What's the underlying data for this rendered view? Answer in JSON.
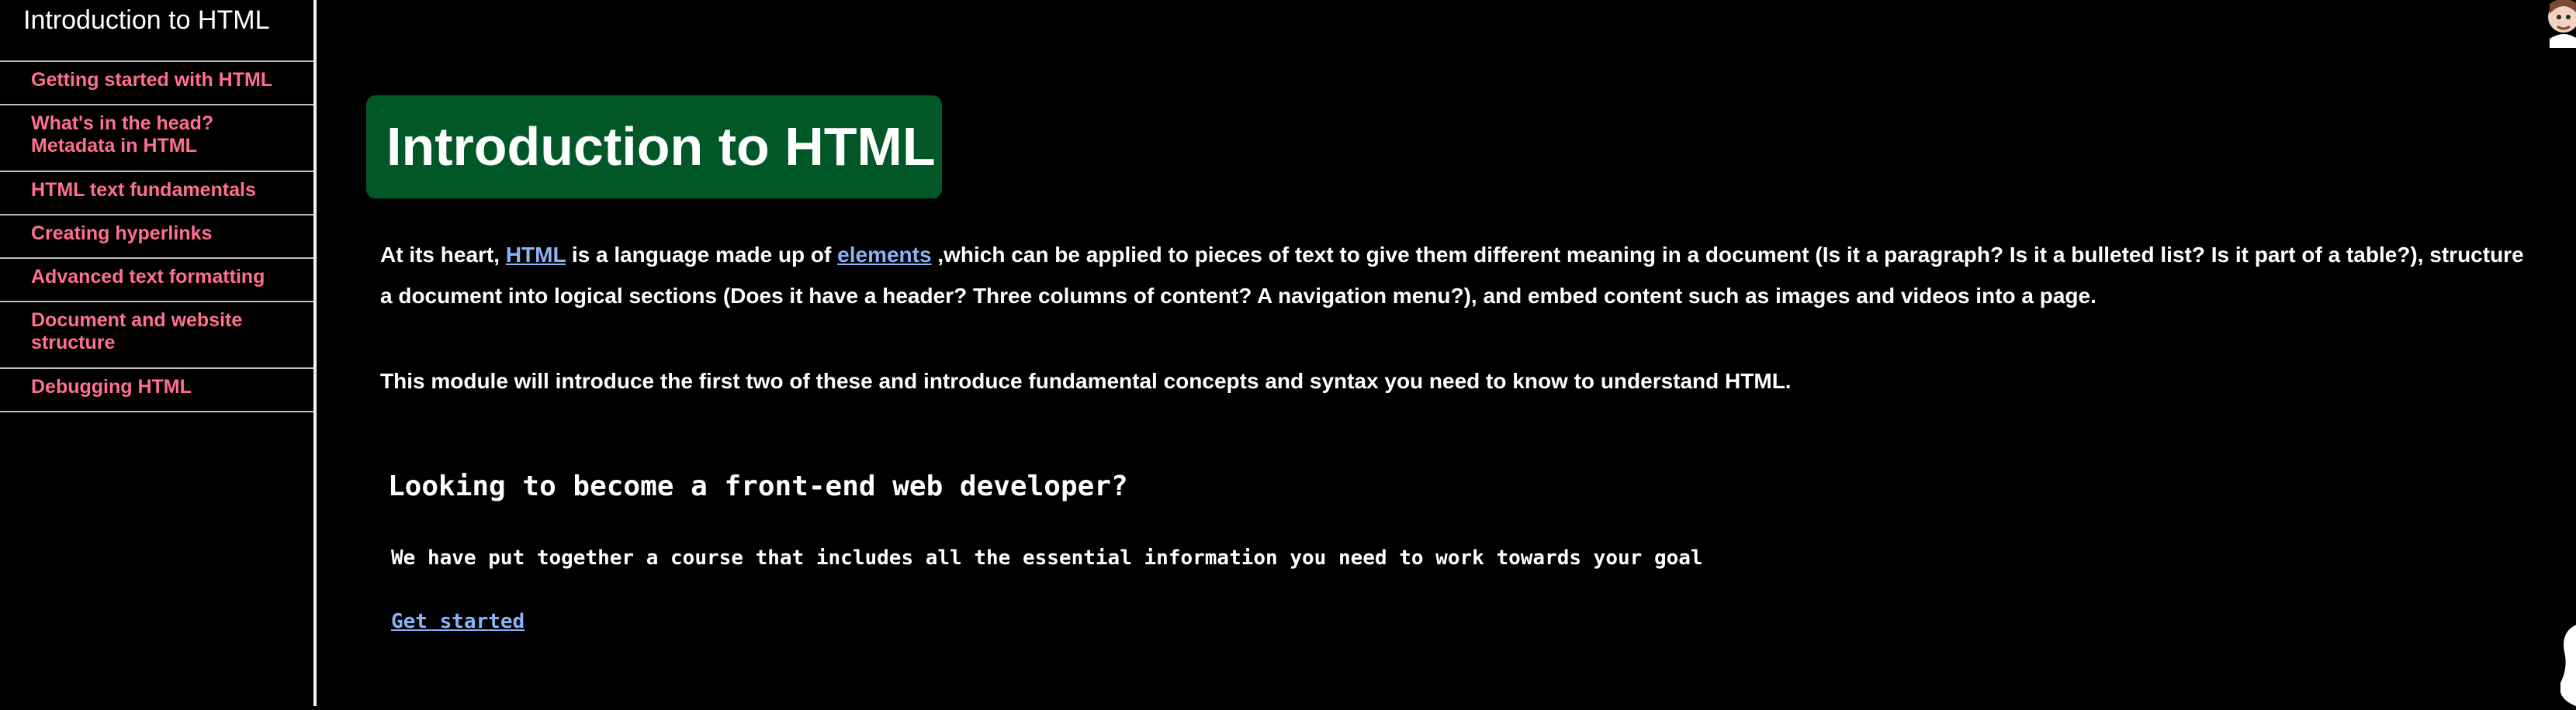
{
  "sidebar": {
    "title": "Introduction to HTML",
    "items": [
      {
        "label": "Getting started with HTML"
      },
      {
        "label": "What's in the head? Metadata in HTML"
      },
      {
        "label": "HTML text fundamentals"
      },
      {
        "label": "Creating hyperlinks"
      },
      {
        "label": "Advanced text formatting"
      },
      {
        "label": "Document and website structure"
      },
      {
        "label": "Debugging HTML"
      }
    ]
  },
  "main": {
    "hero_title": "Introduction to HTML",
    "intro": {
      "prefix": "At its heart, ",
      "html_link": "HTML",
      "middle": " is a language made up of ",
      "elements_link": "elements",
      "suffix": " ,which can be applied to pieces of text to give them different meaning in a document (Is it a paragraph? Is it a bulleted list? Is it part of a table?), structure a document into logical sections (Does it have a header? Three columns of content? A navigation menu?), and embed content such as images and videos into a page."
    },
    "intro_2": "This module will introduce the first two of these and introduce fundamental concepts and syntax you need to know to understand HTML.",
    "course_title": "Looking to become a front-end web developer?",
    "course_description": "We have put together a course that includes all the essential information you need to work towards your goal",
    "get_started": "Get started"
  },
  "icons": {
    "avatar": "avatar-icon",
    "scroll": "scrollbar-thumb-icon"
  },
  "colors": {
    "background": "#000000",
    "sidebar_link": "#ff6f91",
    "hero_background": "#005826",
    "link": "#8ab4f8",
    "text": "#ffffff",
    "divider": "#bfbfbf"
  }
}
